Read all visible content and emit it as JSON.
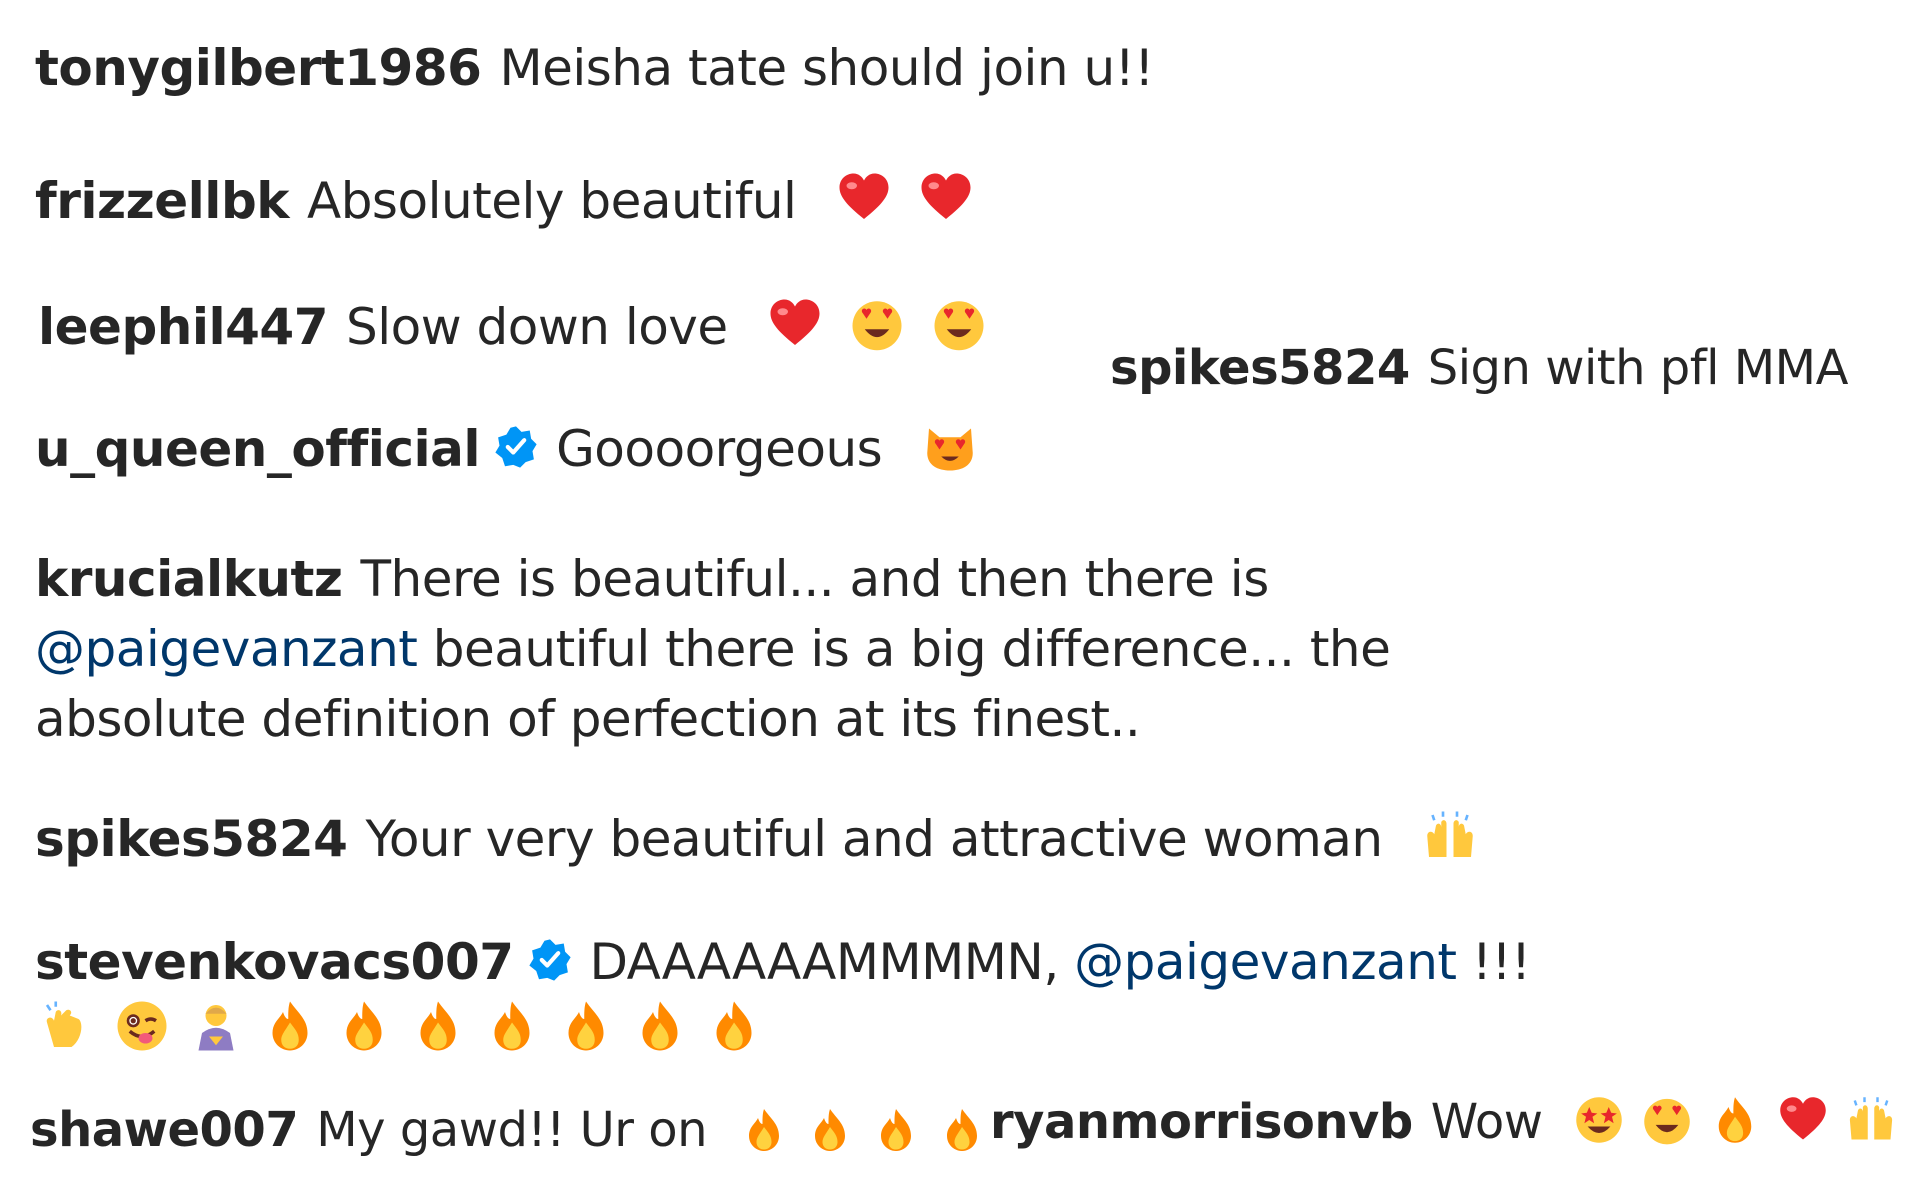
{
  "comments": [
    {
      "user": "tonygilbert1986",
      "text": "Meisha tate should join u!!"
    },
    {
      "user": "frizzellbk",
      "text": "Absolutely beautiful",
      "emojis": [
        "red-heart",
        "red-heart"
      ]
    },
    {
      "user": "leephil447",
      "text": "Slow down love",
      "emojis": [
        "red-heart",
        "heart-eyes",
        "heart-eyes"
      ]
    },
    {
      "user": "spikes5824",
      "text": "Sign with pfl MMA"
    },
    {
      "user": "u_queen_official",
      "verified": true,
      "text": "Goooorgeous",
      "emojis": [
        "heart-eyes-cat"
      ]
    },
    {
      "user": "krucialkutz",
      "text_before": "There is beautiful... and then there is",
      "mention": "@paigevanzant",
      "text_after": "beautiful there is a big difference... the absolute definition of perfection at its finest.."
    },
    {
      "user": "spikes5824",
      "text": "Your very beautiful and attractive woman",
      "emojis": [
        "raising-hands"
      ]
    },
    {
      "user": "stevenkovacs007",
      "verified": true,
      "text_before": "DAAAAAAMMMMN,",
      "mention": "@paigevanzant",
      "text_after": "!!!",
      "emojis": [
        "clapping-hands",
        "winking-face-tongue",
        "person-bowing",
        "fire",
        "fire",
        "fire",
        "fire",
        "fire",
        "fire",
        "fire"
      ]
    },
    {
      "user": "shawe007",
      "text": "My gawd!! Ur on",
      "emojis": [
        "fire",
        "fire",
        "fire",
        "fire"
      ]
    },
    {
      "user": "ryanmorrisonvb",
      "text": "Wow",
      "emojis": [
        "star-struck",
        "heart-eyes",
        "fire",
        "red-heart",
        "raising-hands"
      ]
    }
  ],
  "icons": {
    "verified": "verified-badge-icon",
    "red-heart": "red-heart-icon",
    "heart-eyes": "smiling-face-heart-eyes-icon",
    "heart-eyes-cat": "cat-heart-eyes-icon",
    "raising-hands": "raising-hands-icon",
    "clapping-hands": "clapping-hands-icon",
    "winking-face-tongue": "winking-face-tongue-icon",
    "person-bowing": "person-bowing-icon",
    "fire": "fire-icon",
    "star-struck": "star-struck-icon"
  },
  "colors": {
    "text": "#262626",
    "mention": "#00376b",
    "verified": "#0095f6",
    "heart": "#e8272c",
    "fire_outer": "#ff8a00",
    "fire_inner": "#ffd23f",
    "face": "#ffc83d"
  }
}
